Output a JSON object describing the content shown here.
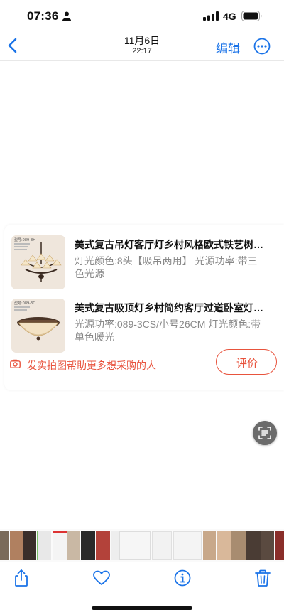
{
  "status_bar": {
    "time": "07:36",
    "network": "4G",
    "icons": [
      "person-icon",
      "signal-icon",
      "battery-icon"
    ]
  },
  "nav": {
    "title": "11月6日",
    "subtitle": "22:17",
    "edit_label": "编辑",
    "icons": [
      "back-icon",
      "more-icon"
    ],
    "accent_color": "#1a73e8"
  },
  "card": {
    "items": [
      {
        "title": "美式复古吊灯客厅灯乡村风格欧式铁艺树…",
        "desc": "灯光颜色:8头【吸吊两用】 光源功率:带三色光源",
        "image": "chandelier-image"
      },
      {
        "title": "美式复古吸顶灯乡村简约客厅过道卧室灯…",
        "desc": "光源功率:089-3CS/小号26CM 灯光颜色:带单色暖光",
        "image": "ceiling-lamp-image"
      }
    ],
    "share_text": "发实拍图帮助更多想采购的人",
    "review_label": "评价",
    "accent_color": "#e8533d"
  },
  "toolbar": {
    "icons": [
      "share-icon",
      "heart-icon",
      "info-icon",
      "trash-icon"
    ]
  }
}
